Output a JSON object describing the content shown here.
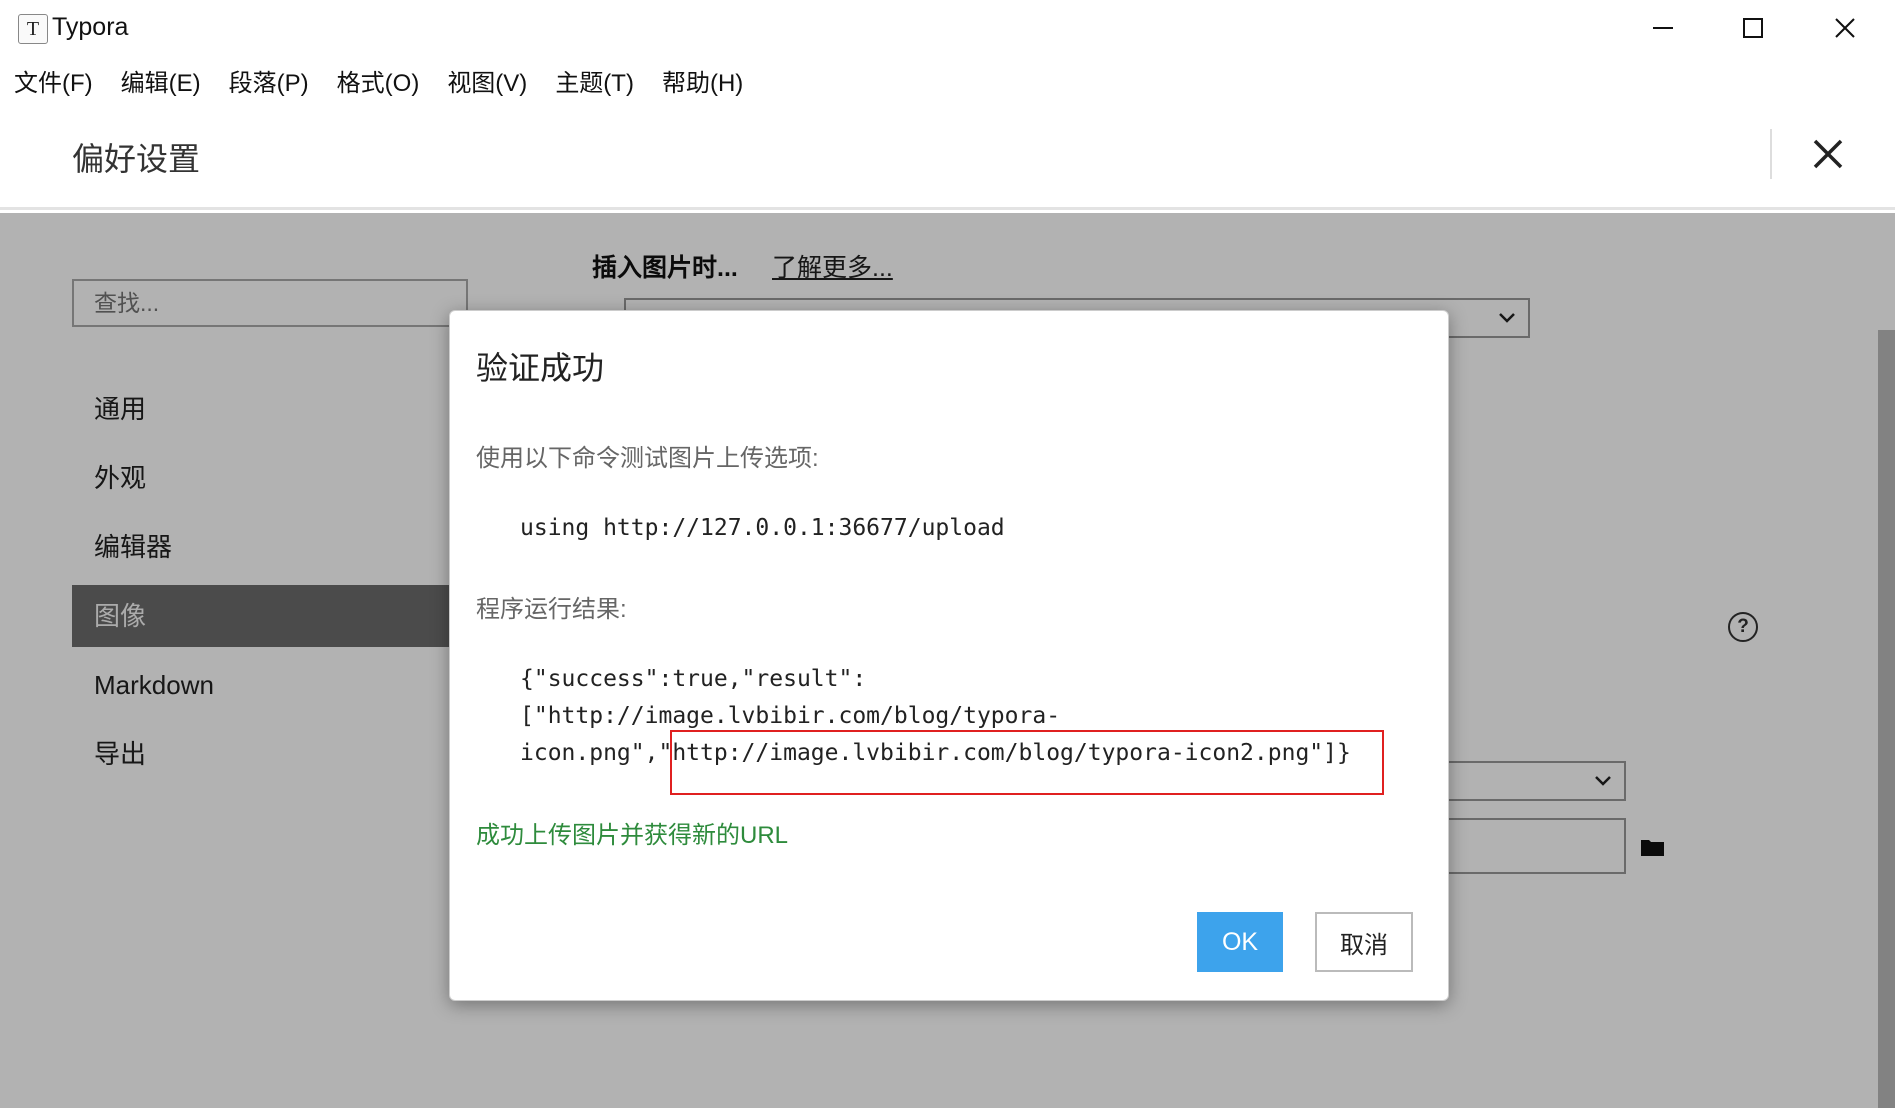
{
  "window": {
    "title": "Typora",
    "app_icon_letter": "T",
    "controls": [
      "minimize-icon",
      "maximize-icon",
      "close-icon"
    ]
  },
  "menubar": {
    "items": [
      "文件(F)",
      "编辑(E)",
      "段落(P)",
      "格式(O)",
      "视图(V)",
      "主题(T)",
      "帮助(H)"
    ]
  },
  "preferences": {
    "title": "偏好设置",
    "search_placeholder": "查找...",
    "nav": [
      "通用",
      "外观",
      "编辑器",
      "图像",
      "Markdown",
      "导出"
    ],
    "active_nav": "图像",
    "section_heading": "插入图片时...",
    "learn_more": "了解更多..."
  },
  "dialog": {
    "title": "验证成功",
    "instruction": "使用以下命令测试图片上传选项:",
    "command": "using http://127.0.0.1:36677/upload",
    "result_label": "程序运行结果:",
    "result_lines": [
      "{\"success\":true,\"result\":",
      "[\"http://image.lvbibir.com/blog/typora-",
      "icon.png\",\"http://image.lvbibir.com/blog/typora-icon2.png\"]}"
    ],
    "success_message": "成功上传图片并获得新的URL",
    "ok_label": "OK",
    "cancel_label": "取消"
  },
  "colors": {
    "ok_button": "#3da3ec",
    "success_text": "#2e8b3c",
    "highlight_border": "#e02020",
    "active_nav_bg": "#6c6c6c"
  }
}
